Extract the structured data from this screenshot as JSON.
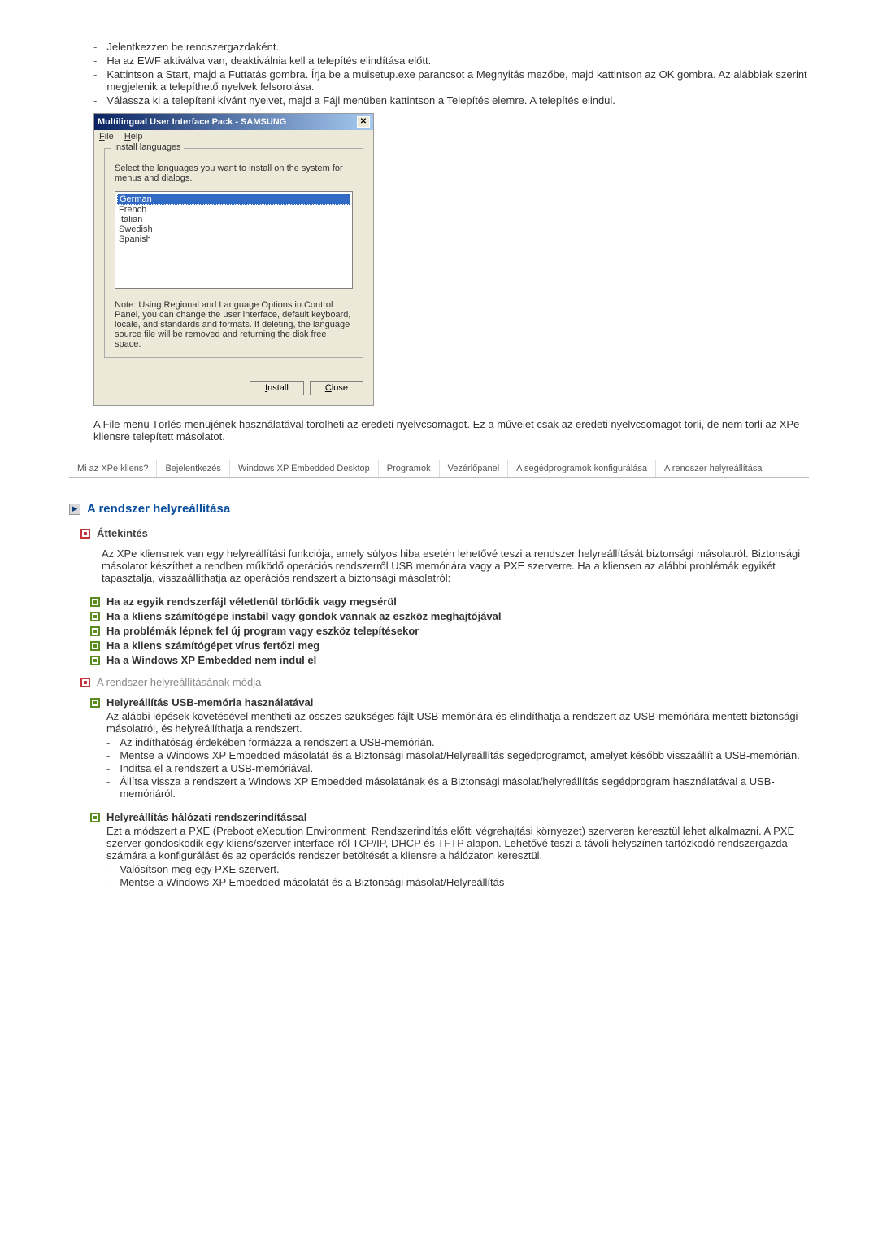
{
  "instructions": [
    "Jelentkezzen be rendszergazdaként.",
    "Ha az EWF aktiválva van, deaktiválnia kell a telepítés elindítása előtt.",
    "Kattintson a Start, majd a Futtatás gombra. Írja be a muisetup.exe parancsot a Megnyitás mezőbe, majd kattintson az OK gombra. Az alábbiak szerint megjelenik a telepíthető nyelvek felsorolása.",
    "Válassza ki a telepíteni kívánt nyelvet, majd a Fájl menüben kattintson a Telepítés elemre. A telepítés elindul."
  ],
  "dialog": {
    "title": "Multilingual User Interface Pack - SAMSUNG",
    "menu_file": "File",
    "menu_help": "Help",
    "legend": "Install languages",
    "select_text": "Select the languages you want to install on the system for menus and dialogs.",
    "languages": [
      "German",
      "French",
      "Italian",
      "Swedish",
      "Spanish"
    ],
    "note": "Note: Using Regional and Language Options in Control Panel, you can change the user interface, default keyboard, locale, and standards and formats. If deleting, the language source file will be removed and returning the disk free space.",
    "btn_install": "Install",
    "btn_close": "Close"
  },
  "para_file_menu": "A File menü Törlés menüjének használatával törölheti az eredeti nyelvcsomagot. Ez a művelet csak az eredeti nyelvcsomagot törli, de nem törli az XPe kliensre telepített másolatot.",
  "tabs": [
    "Mi az XPe kliens?",
    "Bejelentkezés",
    "Windows XP Embedded Desktop",
    "Programok",
    "Vezérlőpanel",
    "A segédprogramok konfigurálása",
    "A rendszer helyreállítása"
  ],
  "section_title": "A rendszer helyreállítása",
  "overview_title": "Áttekintés",
  "overview_text": "Az XPe kliensnek van egy helyreállítási funkciója, amely súlyos hiba esetén lehetővé teszi a rendszer helyreállítását biztonsági másolatról. Biztonsági másolatot készíthet a rendben működő operációs rendszerről USB memóriára vagy a PXE szerverre. Ha a kliensen az alábbi problémák egyikét tapasztalja, visszaállíthatja az operációs rendszert a biztonsági másolatról:",
  "green_items": [
    "Ha az egyik rendszerfájl véletlenül törlődik vagy megsérül",
    "Ha a kliens számítógépe instabil vagy gondok vannak az eszköz meghajtójával",
    "Ha problémák lépnek fel új program vagy eszköz telepítésekor",
    "Ha a kliens számítógépet vírus fertőzi meg",
    "Ha a Windows XP Embedded nem indul el"
  ],
  "methods_title": "A rendszer helyreállításának módja",
  "method1": {
    "title": "Helyreállítás USB-memória használatával",
    "intro": "Az alábbi lépések követésével mentheti az összes szükséges fájlt USB-memóriára és elindíthatja a rendszert az USB-memóriára mentett biztonsági másolatról, és helyreállíthatja a rendszert.",
    "items": [
      "Az indíthatóság érdekében formázza a rendszert a USB-memórián.",
      "Mentse a Windows XP Embedded másolatát és a Biztonsági másolat/Helyreállítás segédprogramot, amelyet később visszaállít a USB-memórián.",
      "Indítsa el a rendszert a USB-memóriával.",
      "Állítsa vissza a rendszert a Windows XP Embedded másolatának és a Biztonsági másolat/helyreállítás segédprogram használatával a USB-memóriáról."
    ]
  },
  "method2": {
    "title": "Helyreállítás hálózati rendszerindítással",
    "intro": "Ezt a módszert a PXE (Preboot eXecution Environment: Rendszerindítás előtti végrehajtási környezet) szerveren keresztül lehet alkalmazni. A PXE szerver gondoskodik egy kliens/szerver interface-ről TCP/IP, DHCP és TFTP alapon. Lehetővé teszi a távoli helyszínen tartózkodó rendszergazda számára a konfigurálást és az operációs rendszer betöltését a kliensre a hálózaton keresztül.",
    "items": [
      "Valósítson meg egy PXE szervert.",
      "Mentse a Windows XP Embedded másolatát és a Biztonsági másolat/Helyreállítás"
    ]
  }
}
